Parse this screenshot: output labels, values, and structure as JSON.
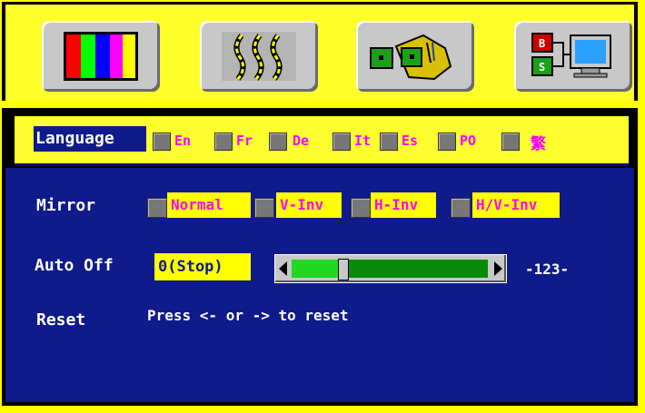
{
  "top_icons": [
    {
      "name": "color-bars-icon"
    },
    {
      "name": "geometry-wave-icon"
    },
    {
      "name": "tools-icon"
    },
    {
      "name": "input-source-icon"
    }
  ],
  "language": {
    "label": "Language",
    "options": [
      "En",
      "Fr",
      "De",
      "It",
      "Es",
      "PO",
      "繁"
    ]
  },
  "mirror": {
    "label": "Mirror",
    "options": [
      "Normal",
      "V-Inv",
      "H-Inv",
      "H/V-Inv"
    ]
  },
  "auto_off": {
    "label": "Auto Off",
    "value": "0(Stop)",
    "readout": "-123-",
    "slider_fraction": 0.26
  },
  "reset": {
    "label": "Reset",
    "hint": "Press <- or -> to reset"
  },
  "colors": {
    "background_blue": "#0f1b8a",
    "highlight_yellow": "#ffff00",
    "option_magenta": "#ff00ff"
  }
}
